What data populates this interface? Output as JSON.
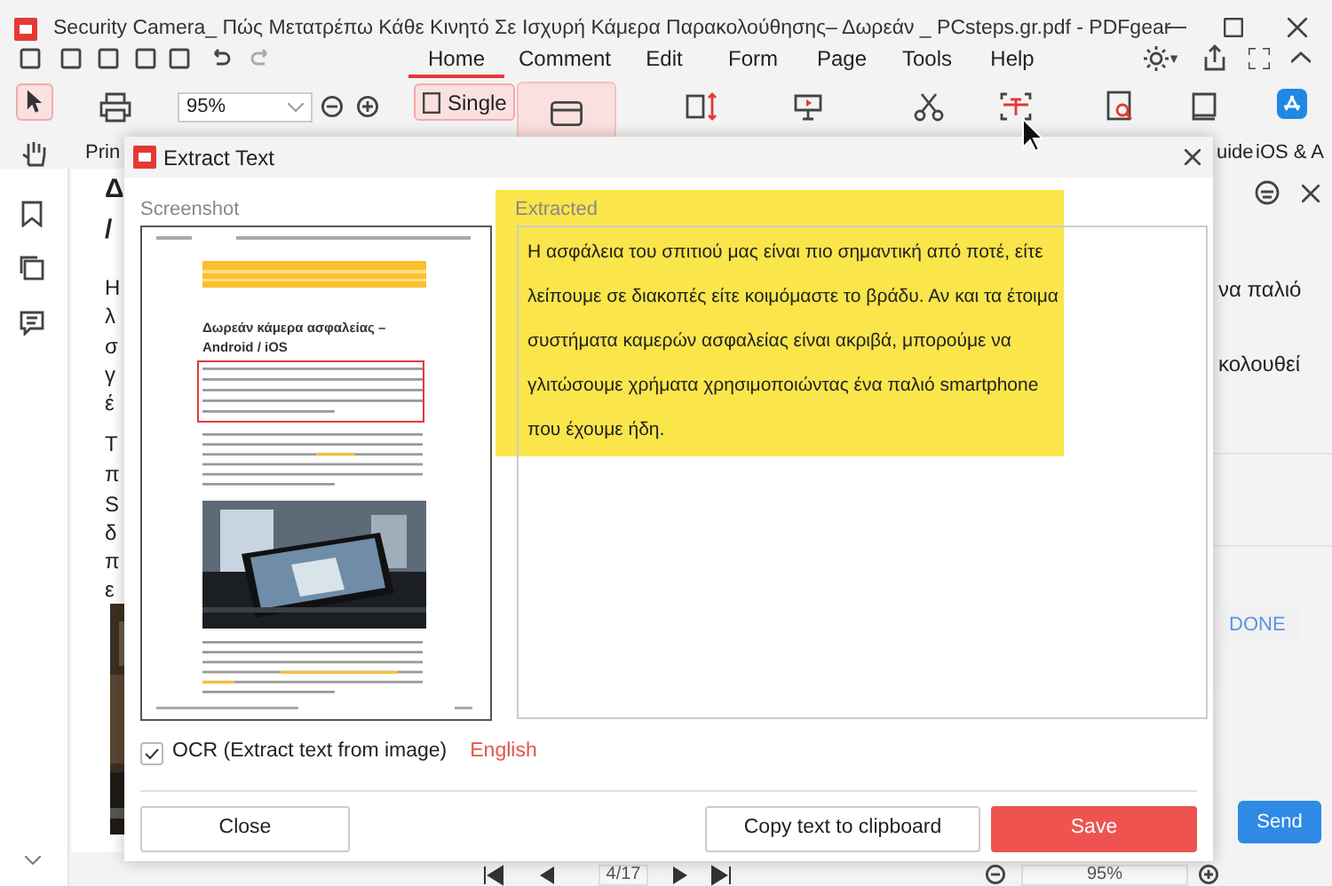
{
  "window": {
    "title": "Security Camera_ Πώς Μετατρέπω Κάθε Κινητό Σε Ισχυρή Κάμερα Παρακολούθησης– Δωρεάν _ PCsteps.gr.pdf - PDFgear"
  },
  "menu_tabs": [
    {
      "label": "Home",
      "selected": true
    },
    {
      "label": "Comment",
      "selected": false
    },
    {
      "label": "Edit",
      "selected": false
    },
    {
      "label": "Form",
      "selected": false
    },
    {
      "label": "Page",
      "selected": false
    },
    {
      "label": "Tools",
      "selected": false
    },
    {
      "label": "Help",
      "selected": false
    }
  ],
  "tools": [
    {
      "kind": "select",
      "selected": true
    },
    {
      "kind": "hand",
      "selected": false
    }
  ],
  "ribbon": {
    "print_label": "Prin",
    "zoom_value": "95%",
    "view_mode": "Single",
    "guide_label": "uide",
    "ios_label": "iOS & A"
  },
  "document_fragments": [
    "Δ",
    "/",
    "H",
    "λ",
    "σ",
    "γ",
    "έ",
    "Τ",
    "π",
    "S",
    "δ",
    "π",
    "ε"
  ],
  "side_panel": {
    "snippets": [
      "να παλιό",
      "κολουθεί"
    ],
    "done_button": "DONE",
    "send_button": "Send"
  },
  "page_nav": {
    "page": "4/17",
    "zoom": "95%"
  },
  "dialog": {
    "title": "Extract Text",
    "screenshot_label": "Screenshot",
    "preview_heading": "Δωρεάν κάμερα ασφαλείας – Android / iOS",
    "extracted_label": "Extracted",
    "extracted_text": "Η ασφάλεια του σπιτιού μας είναι πιο σημαντική από ποτέ, είτε λείπουμε σε διακοπές είτε κοιμόμαστε το βράδυ. Αν και τα έτοιμα συστήματα καμερών ασφαλείας είναι ακριβά, μπορούμε να γλιτώσουμε χρήματα χρησιμοποιώντας ένα παλιό smartphone που έχουμε ήδη.",
    "highlighted": true,
    "ocr": {
      "label": "OCR (Extract text from image)",
      "checked": true,
      "language": "English"
    },
    "buttons": [
      {
        "label": "Close",
        "kind": "secondary"
      },
      {
        "label": "Copy text to clipboard",
        "kind": "secondary"
      },
      {
        "label": "Save",
        "kind": "primary"
      }
    ]
  }
}
